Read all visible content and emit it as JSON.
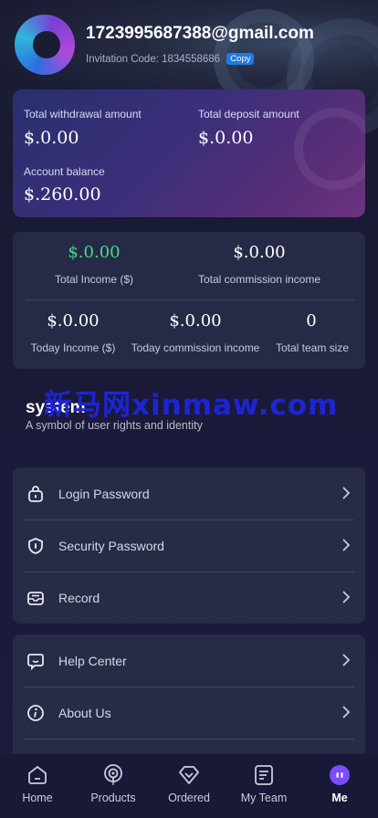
{
  "profile": {
    "email": "1723995687388@gmail.com",
    "invitation_label": "Invitation Code:",
    "invitation_code": "1834558686",
    "copy_label": "Copy"
  },
  "balance": {
    "withdrawal_label": "Total withdrawal amount",
    "withdrawal_value": "$.0.00",
    "deposit_label": "Total deposit amount",
    "deposit_value": "$.0.00",
    "account_label": "Account balance",
    "account_value": "$.260.00"
  },
  "stats": {
    "total_income_value": "$.0.00",
    "total_income_label": "Total Income ($)",
    "total_commission_value": "$.0.00",
    "total_commission_label": "Total commission income",
    "today_income_value": "$.0.00",
    "today_income_label": "Today Income ($)",
    "today_commission_value": "$.0.00",
    "today_commission_label": "Today commission income",
    "team_size_value": "0",
    "team_size_label": "Total team size",
    "highlight_color": "#3ddc84"
  },
  "system": {
    "title": "system",
    "subtitle": "A symbol of user rights and identity",
    "watermark": "新马网xinmaw.com"
  },
  "menu_group1": {
    "items": [
      {
        "label": "Login Password",
        "icon": "lock-icon"
      },
      {
        "label": "Security Password",
        "icon": "shield-icon"
      },
      {
        "label": "Record",
        "icon": "envelope-icon"
      }
    ]
  },
  "menu_group2": {
    "items": [
      {
        "label": "Help Center",
        "icon": "chat-icon"
      },
      {
        "label": "About Us",
        "icon": "info-icon"
      }
    ]
  },
  "nav": {
    "items": [
      {
        "label": "Home",
        "icon": "home-icon"
      },
      {
        "label": "Products",
        "icon": "podcast-icon"
      },
      {
        "label": "Ordered",
        "icon": "diamond-icon"
      },
      {
        "label": "My Team",
        "icon": "document-icon"
      },
      {
        "label": "Me",
        "icon": "profile-icon"
      }
    ],
    "active": "Me",
    "accent": "#7c4dff"
  }
}
